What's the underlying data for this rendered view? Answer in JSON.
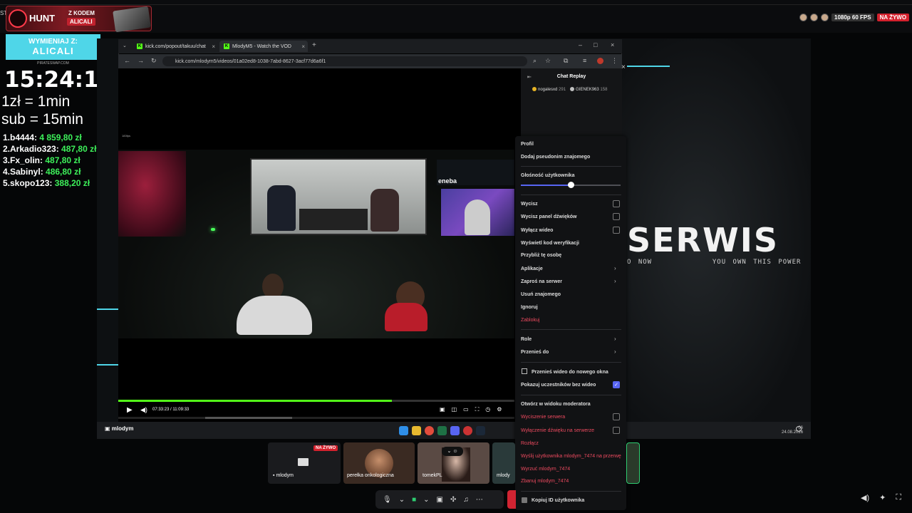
{
  "stream": {
    "left_edge_text": "STI",
    "hunt": {
      "brand": "HUNT",
      "code_label": "Z KODEM",
      "code": "ALICALI"
    },
    "quality_badge": "1080p 60 FPS",
    "live_badge": "NA ŻYWO",
    "promo": {
      "line1": "WYMIENIAJ Z:",
      "line2": "ALICALI",
      "sub": "PIRATESWAP.COM"
    },
    "timer": "15:24:14",
    "rate_zl": "1zł = 1min",
    "rate_sub": "sub = 15min",
    "leaderboard": [
      {
        "rank_name": "1.b4444:",
        "amount": "4 859,80 zł"
      },
      {
        "rank_name": "2.Arkadio323:",
        "amount": "487,80 zł"
      },
      {
        "rank_name": "3.Fx_olin:",
        "amount": "487,80 zł"
      },
      {
        "rank_name": "4.Sabinyl:",
        "amount": "486,80 zł"
      },
      {
        "rank_name": "5.skopo123:",
        "amount": "388,20 zł"
      }
    ],
    "serwis": "SERWIS",
    "tagline_left": "O NOW",
    "tagline_right": "YOU OWN THIS POWER",
    "stage_user": "mlodym",
    "date": "24.08.2026",
    "clock_small": "06"
  },
  "browser": {
    "tabs": [
      {
        "title": "kick.com/popout/takuu/chat",
        "active": false
      },
      {
        "title": "MlodyM5 - Watch the VOD",
        "active": true
      }
    ],
    "url": "kick.com/mlodym5/videos/01a02ed8-1038-7abd-8627-3acf77d6a6f1",
    "video_time": "07:33:23 / 11:09:33",
    "fps_tag": "183fps",
    "sponsor": "eneba",
    "progress": 0.69,
    "scrub_start": 0.22,
    "scrub_width": 0.22
  },
  "chat": {
    "title": "Chat Replay",
    "users": [
      {
        "name": "nogalesxd",
        "points": "291"
      },
      {
        "name": "GIENEK963",
        "points": "158"
      }
    ]
  },
  "menu": {
    "items": [
      {
        "label": "Profil"
      },
      {
        "label": "Dodaj pseudonim znajomego"
      },
      {
        "label": "Głośność użytkownika"
      },
      {
        "label": "Wycisz"
      },
      {
        "label": "Wycisz panel dźwięków"
      },
      {
        "label": "Wyłącz wideo"
      },
      {
        "label": "Wyświetl kod weryfikacji"
      },
      {
        "label": "Przybliż tę osobę"
      },
      {
        "label": "Aplikacje"
      },
      {
        "label": "Zaproś na serwer"
      },
      {
        "label": "Usuń znajomego"
      },
      {
        "label": "Ignoruj"
      },
      {
        "label": "Zablokuj"
      },
      {
        "label": "Role"
      },
      {
        "label": "Przenieś do"
      },
      {
        "label": "Przenieś wideo do nowego okna"
      },
      {
        "label": "Pokazuj uczestników bez wideo"
      },
      {
        "label": "Otwórz w widoku moderatora"
      },
      {
        "label": "Wyciszenie serwera"
      },
      {
        "label": "Wyłączenie dźwięku na serwerze"
      },
      {
        "label": "Rozłącz"
      },
      {
        "label": "Wyślij użytkownika mlodym_7474 na przerwę"
      },
      {
        "label": "Wyrzuć mlodym_7474"
      },
      {
        "label": "Zbanuj mlodym_7474"
      },
      {
        "label": "Kopiuj ID użytkownika"
      }
    ],
    "volume": 0.5,
    "show_without_video_checked": true
  },
  "tiles": [
    {
      "label": "mlodym",
      "badge": "NA ŻYWO"
    },
    {
      "label": "perełka onkologiczna"
    },
    {
      "label": "tomekPL"
    },
    {
      "label": "mlody"
    }
  ],
  "colors": {
    "kick_green": "#53fc18",
    "accent_cyan": "#4fd6e8",
    "discord_blurple": "#5865f2",
    "danger": "#ed4a5f",
    "donation_green": "#3df05a"
  }
}
